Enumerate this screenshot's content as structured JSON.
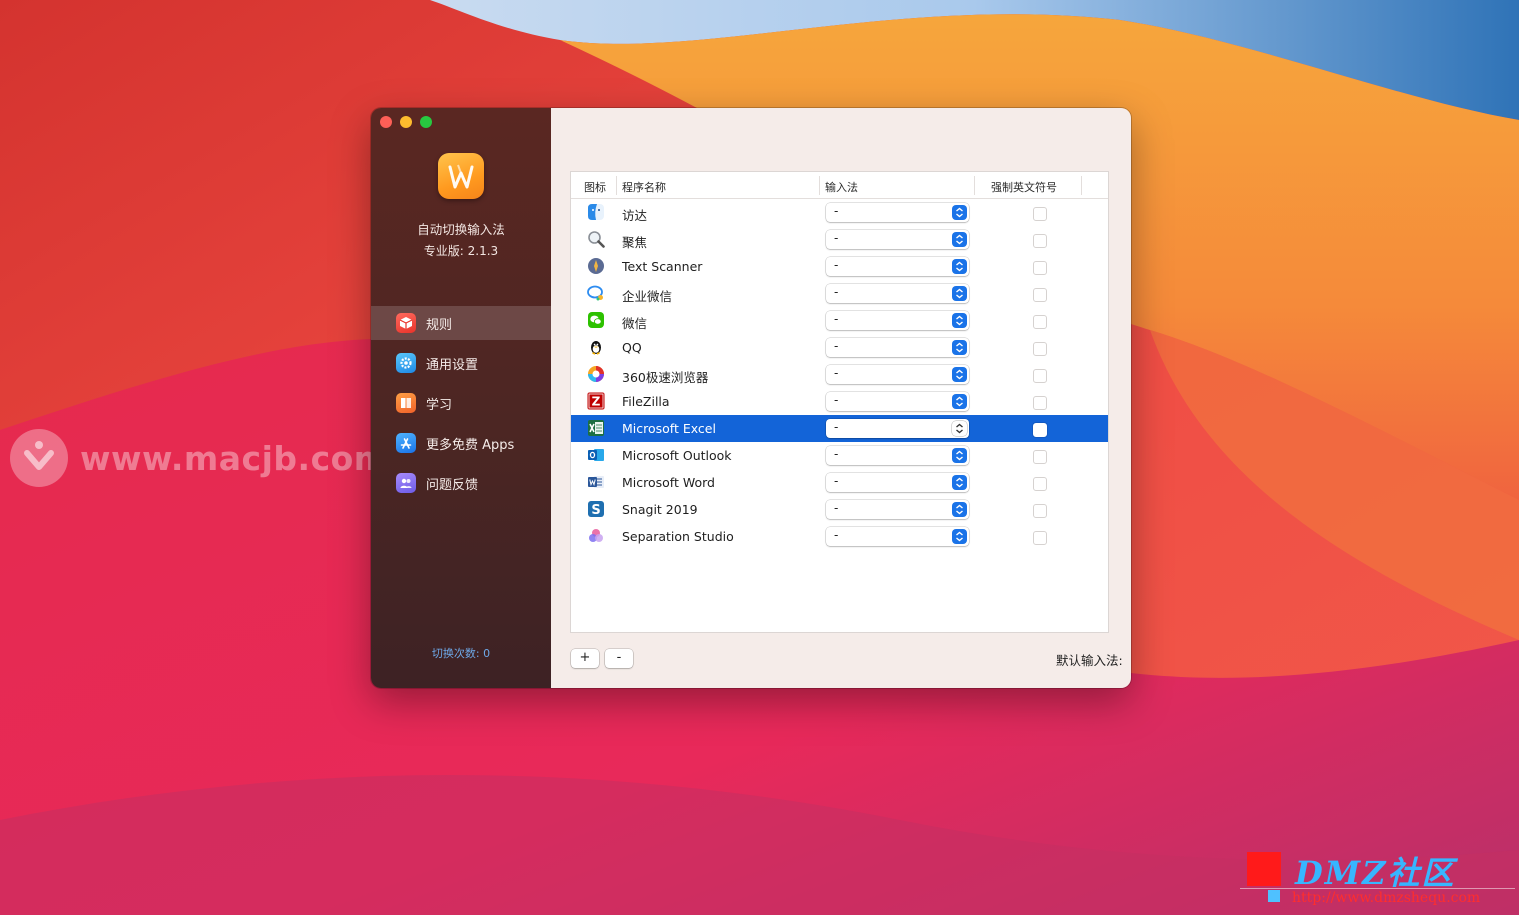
{
  "wallpaper": {
    "colors": [
      "#c8302f",
      "#f04e45",
      "#f7933a",
      "#e3224a",
      "#2a6fb8",
      "#b9d6ee"
    ]
  },
  "app": {
    "name": "自动切换输入法",
    "version": "专业版: 2.1.3",
    "icon": "app-logo-icon",
    "accent": "#ff9a1f"
  },
  "nav": [
    {
      "label": "规则",
      "icon": "rules-cube-icon",
      "active": true
    },
    {
      "label": "通用设置",
      "icon": "gear-icon",
      "active": false
    },
    {
      "label": "学习",
      "icon": "book-icon",
      "active": false
    },
    {
      "label": "更多免费 Apps",
      "icon": "app-store-icon",
      "active": false
    },
    {
      "label": "问题反馈",
      "icon": "feedback-people-icon",
      "active": false
    }
  ],
  "switch_count": "切换次数: 0",
  "table": {
    "headers": {
      "icon": "图标",
      "name": "程序名称",
      "input_method": "输入法",
      "force_english": "强制英文符号"
    },
    "rows": [
      {
        "icon": "finder-icon",
        "name": "访达",
        "input": "-",
        "checked": false,
        "selected": false
      },
      {
        "icon": "spotlight-icon",
        "name": "聚焦",
        "input": "-",
        "checked": false,
        "selected": false
      },
      {
        "icon": "text-scanner-icon",
        "name": "Text Scanner",
        "input": "-",
        "checked": false,
        "selected": false
      },
      {
        "icon": "wecom-icon",
        "name": "企业微信",
        "input": "-",
        "checked": false,
        "selected": false
      },
      {
        "icon": "wechat-icon",
        "name": "微信",
        "input": "-",
        "checked": false,
        "selected": false
      },
      {
        "icon": "qq-icon",
        "name": "QQ",
        "input": "-",
        "checked": false,
        "selected": false
      },
      {
        "icon": "360-browser-icon",
        "name": "360极速浏览器",
        "input": "-",
        "checked": false,
        "selected": false
      },
      {
        "icon": "filezilla-icon",
        "name": "FileZilla",
        "input": "-",
        "checked": false,
        "selected": false
      },
      {
        "icon": "excel-icon",
        "name": "Microsoft Excel",
        "input": "-",
        "checked": false,
        "selected": true
      },
      {
        "icon": "outlook-icon",
        "name": "Microsoft Outlook",
        "input": "-",
        "checked": false,
        "selected": false
      },
      {
        "icon": "word-icon",
        "name": "Microsoft Word",
        "input": "-",
        "checked": false,
        "selected": false
      },
      {
        "icon": "snagit-icon",
        "name": "Snagit 2019",
        "input": "-",
        "checked": false,
        "selected": false
      },
      {
        "icon": "separation-studio-icon",
        "name": "Separation Studio",
        "input": "-",
        "checked": false,
        "selected": false
      }
    ]
  },
  "footer": {
    "add_label": "+",
    "remove_label": "-",
    "default_label": "默认输入法:",
    "default_value": "-"
  },
  "watermarks": {
    "left_text": "www.macjb.com",
    "right_title": "DMZ社区",
    "right_url": "http://www.dmzshequ.com"
  }
}
